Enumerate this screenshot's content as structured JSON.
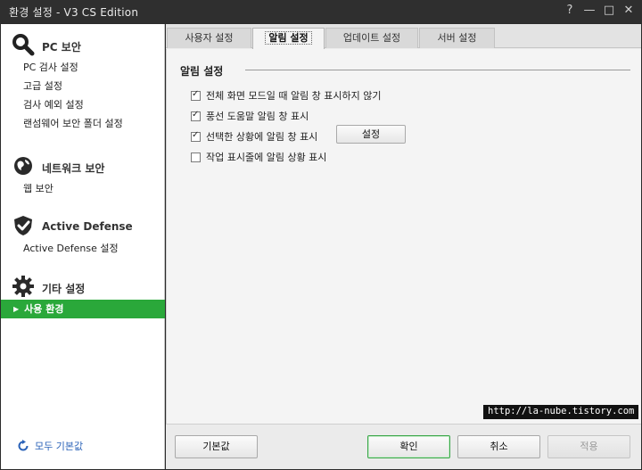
{
  "window": {
    "title": "환경 설정 - V3 CS Edition",
    "help_glyph": "?",
    "minimize_glyph": "—",
    "maximize_glyph": "□",
    "close_glyph": "✕"
  },
  "sidebar": {
    "sections": [
      {
        "title": "PC 보안",
        "icon": "magnifier-icon",
        "items": [
          {
            "label": "PC 검사 설정"
          },
          {
            "label": "고급 설정"
          },
          {
            "label": "검사 예외 설정"
          },
          {
            "label": "랜섬웨어 보안 폴더 설정"
          }
        ]
      },
      {
        "title": "네트워크 보안",
        "icon": "globe-icon",
        "items": [
          {
            "label": "웹 보안"
          }
        ]
      },
      {
        "title": "Active Defense",
        "icon": "shield-check-icon",
        "items": [
          {
            "label": "Active Defense 설정"
          }
        ]
      },
      {
        "title": "기타 설정",
        "icon": "gear-icon",
        "items": [
          {
            "label": "사용 환경",
            "active": true
          }
        ]
      }
    ],
    "reset_all_label": "모두 기본값"
  },
  "tabs": [
    {
      "label": "사용자 설정"
    },
    {
      "label": "알림 설정",
      "active": true
    },
    {
      "label": "업데이트 설정"
    },
    {
      "label": "서버 설정"
    }
  ],
  "panel": {
    "group_title": "알림 설정",
    "options": [
      {
        "label": "전체 화면 모드일 때 알림 창 표시하지 않기",
        "checked": true
      },
      {
        "label": "풍선 도움말 알림 창 표시",
        "checked": true
      },
      {
        "label": "선택한 상황에 알림 창 표시",
        "checked": true
      },
      {
        "label": "작업 표시줄에 알림 상황 표시",
        "checked": false
      }
    ],
    "settings_button": "설정"
  },
  "buttons": {
    "default": "기본값",
    "ok": "확인",
    "cancel": "취소",
    "apply": "적용"
  },
  "watermark": "http://la-nube.tistory.com",
  "colors": {
    "active_item": "#2aa83a",
    "titlebar": "#2f2f2f",
    "link": "#2a62b8"
  }
}
